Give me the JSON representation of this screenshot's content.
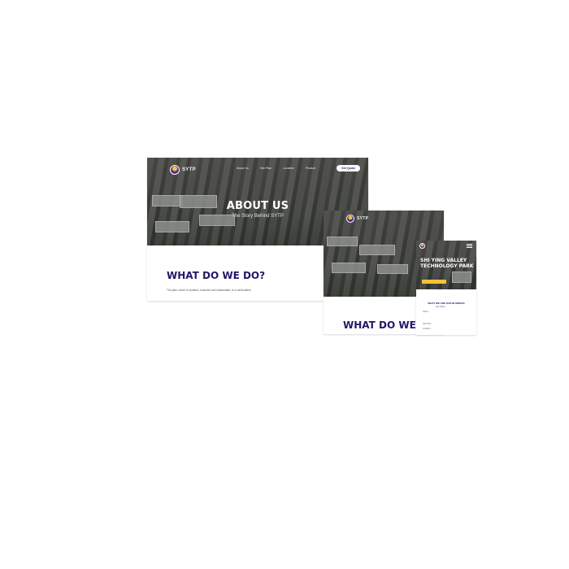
{
  "brand": {
    "name": "SYTP",
    "logo_color": "#5a2d91",
    "logo_accent": "#f6c53a"
  },
  "desktop": {
    "nav": {
      "links": [
        "About Us",
        "Site Plan",
        "Location",
        "Product"
      ],
      "cta": "Get Quote"
    },
    "hero": {
      "title": "ABOUT US",
      "subtitle": "The Story Behind SYTP"
    },
    "section": {
      "heading": "WHAT DO WE DO?",
      "body": "The plan, which is dynamic, inclusive and sustainable, is a continuation"
    }
  },
  "tablet": {
    "section_heading": "WHAT DO WE"
  },
  "phone": {
    "hero_title": "SHI YING VALLEY TECHNOLOGY PARK",
    "section_heading": "WHAT WE ARE OUR BUSINESS",
    "tagline": "Our vision",
    "body_lines": [
      "About",
      "",
      "Site Plan",
      "Location"
    ]
  },
  "colors": {
    "heading": "#241669",
    "cta_yellow": "#f2c23a"
  }
}
